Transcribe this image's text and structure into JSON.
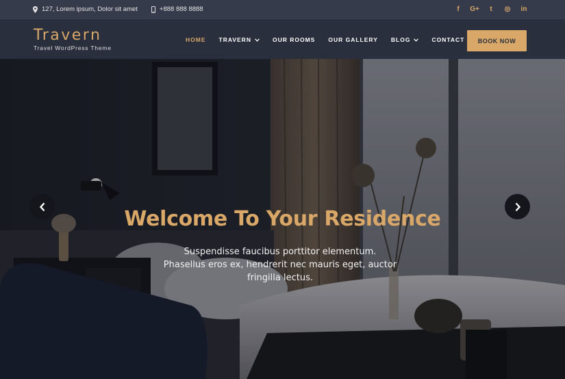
{
  "topbar": {
    "address": "127, Lorem ipsum, Dolor sit amet",
    "phone": "+888 888 8888",
    "social": [
      {
        "icon": "facebook-icon",
        "glyph": "f"
      },
      {
        "icon": "google-plus-icon",
        "glyph": "G+"
      },
      {
        "icon": "twitter-icon",
        "glyph": "t"
      },
      {
        "icon": "instagram-icon",
        "glyph": "◎"
      },
      {
        "icon": "linkedin-icon",
        "glyph": "in"
      }
    ]
  },
  "header": {
    "logo": "Travern",
    "tagline": "Travel WordPress Theme",
    "nav": [
      {
        "label": "HOME",
        "active": true,
        "dropdown": false
      },
      {
        "label": "TRAVERN",
        "active": false,
        "dropdown": true
      },
      {
        "label": "OUR ROOMS",
        "active": false,
        "dropdown": false
      },
      {
        "label": "OUR GALLERY",
        "active": false,
        "dropdown": false
      },
      {
        "label": "BLOG",
        "active": false,
        "dropdown": true
      },
      {
        "label": "CONTACT US",
        "active": false,
        "dropdown": false
      }
    ],
    "book_label": "BOOK NOW"
  },
  "hero": {
    "title": "Welcome To Your Residence",
    "text": "Suspendisse faucibus porttitor elementum. Phasellus eros ex, hendrerit nec mauris eget, auctor fringilla lectus."
  },
  "colors": {
    "accent": "#d9a869",
    "topbar_bg": "#353b4b",
    "header_bg": "#2a2f3d"
  }
}
